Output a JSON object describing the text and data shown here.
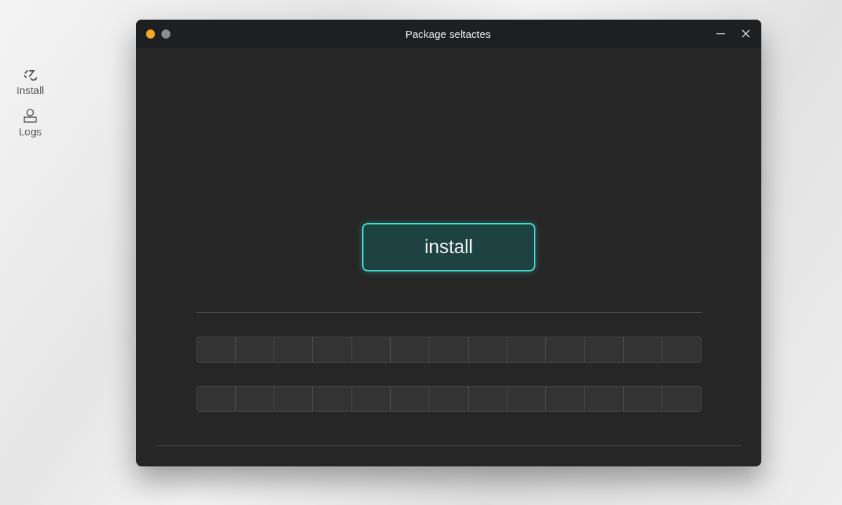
{
  "sidebar": {
    "items": [
      {
        "label": "Install",
        "kind": "install"
      },
      {
        "label": "Logs",
        "kind": "logs"
      }
    ]
  },
  "window": {
    "title": "Package seltactes",
    "dots": [
      {
        "color": "#f5a623"
      },
      {
        "color": "#8e8e90"
      }
    ]
  },
  "install_button": {
    "label": "install"
  },
  "segment_rows": [
    {
      "kind": "segmented"
    },
    {
      "kind": "segmented"
    }
  ]
}
